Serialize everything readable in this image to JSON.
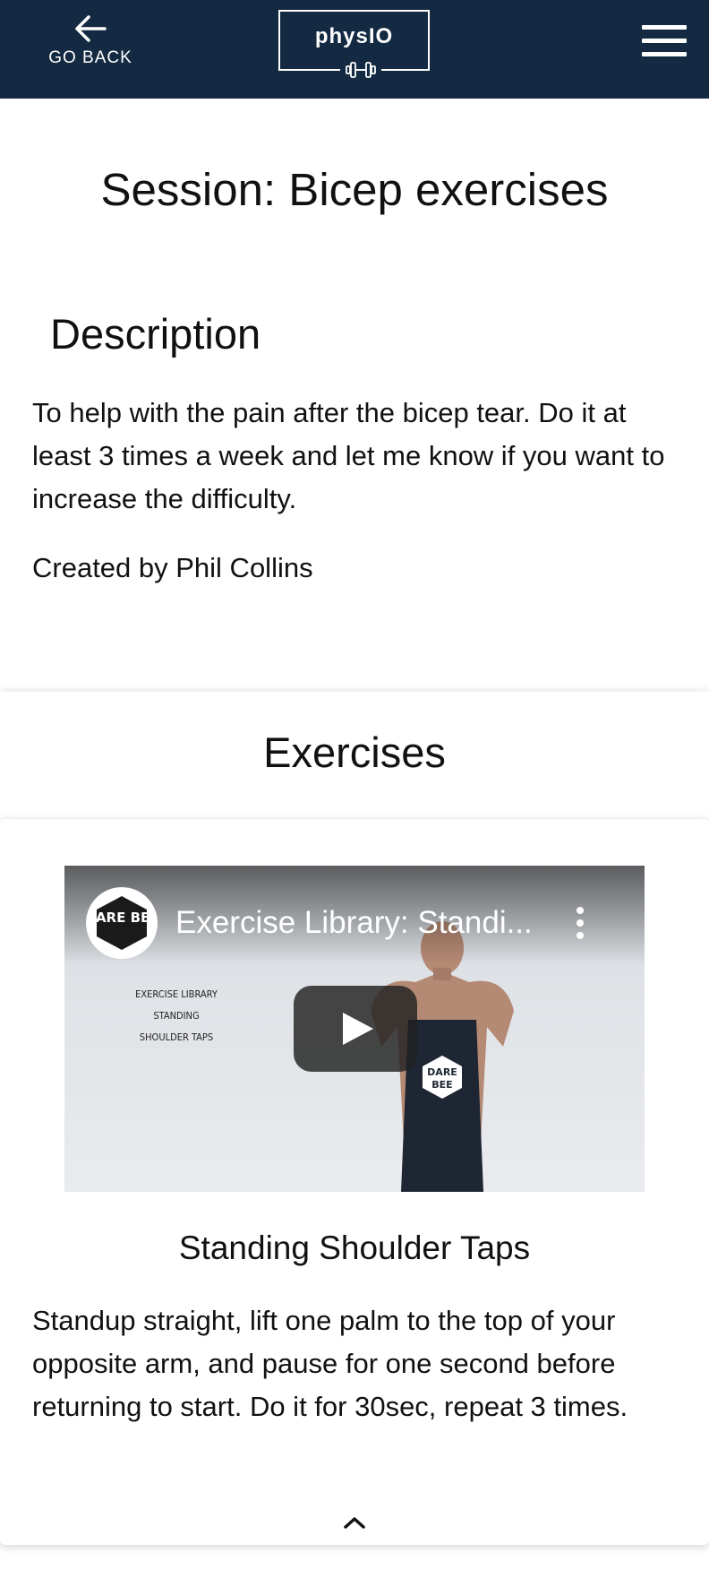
{
  "header": {
    "back_label": "GO BACK",
    "logo_text": "physIO",
    "background_color": "#132a42"
  },
  "session": {
    "title": "Session: Bicep exercises"
  },
  "description": {
    "heading": "Description",
    "text": "To help with the pain after the bicep tear. Do it at least 3 times a week and let me know if you want to increase the difficulty.",
    "created_by": "Created by Phil Collins"
  },
  "exercises": {
    "heading": "Exercises",
    "items": [
      {
        "video": {
          "title": "Exercise Library: Standi...",
          "channel_logo_text": "DARE BEE",
          "overlay_lines": [
            "EXERCISE LIBRARY",
            "STANDING",
            "SHOULDER TAPS"
          ]
        },
        "name": "Standing Shoulder Taps",
        "description": "Standup straight, lift one palm to the top of your opposite arm, and pause for one second before returning to start. Do it for 30sec, repeat 3 times."
      }
    ]
  },
  "icons": {
    "back": "arrow-left-icon",
    "logo": "dumbbell-icon",
    "menu": "hamburger-menu-icon",
    "collapse": "chevron-up-icon",
    "video_more": "more-vertical-icon",
    "play": "play-icon"
  }
}
